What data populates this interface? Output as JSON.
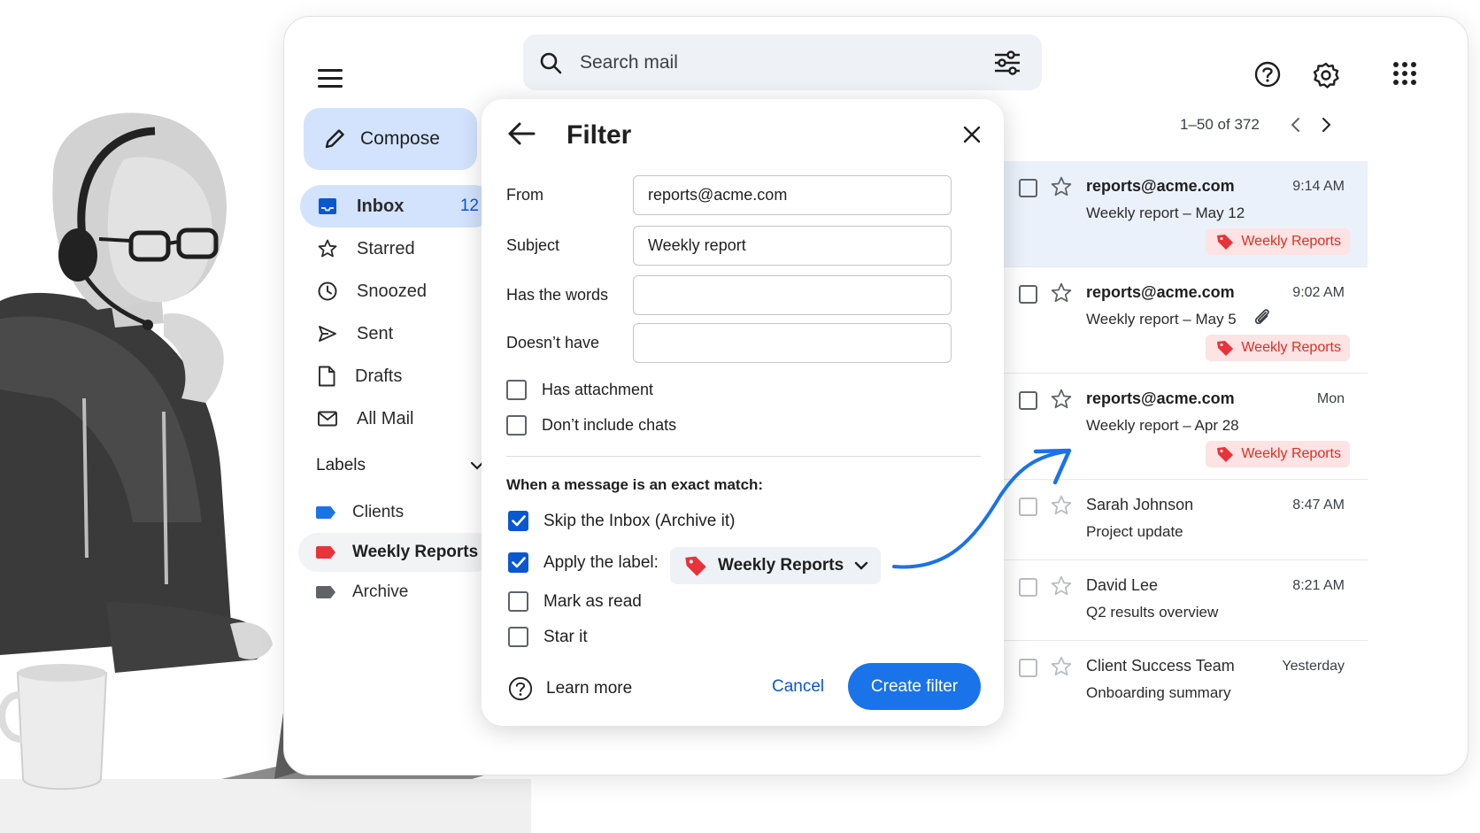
{
  "colors": {
    "accent": "#1a73e8",
    "label_red": "#e8333a",
    "label_blue": "#1a73e8",
    "label_gray": "#5f6368",
    "active_bg": "#d3e3fd"
  },
  "header": {
    "search_placeholder": "Search mail"
  },
  "sidebar": {
    "compose_label": "Compose",
    "items": [
      {
        "label": "Inbox",
        "count": "12",
        "icon": "inbox-icon",
        "active": true
      },
      {
        "label": "Starred",
        "icon": "star-icon"
      },
      {
        "label": "Snoozed",
        "icon": "clock-icon"
      },
      {
        "label": "Sent",
        "icon": "send-icon"
      },
      {
        "label": "Drafts",
        "icon": "draft-icon"
      },
      {
        "label": "All Mail",
        "icon": "mail-icon"
      }
    ],
    "labels_heading": "Labels",
    "labels": [
      {
        "name": "Clients",
        "color": "#1a73e8"
      },
      {
        "name": "Weekly Reports",
        "color": "#e8333a",
        "active": true
      },
      {
        "name": "Archive",
        "color": "#5f6368"
      }
    ]
  },
  "pagination": {
    "text": "1–50 of 372"
  },
  "emails": [
    {
      "sender": "reports@acme.com",
      "subject": "Weekly report – May 12",
      "time": "9:14 AM",
      "label": "Weekly Reports"
    },
    {
      "sender": "reports@acme.com",
      "subject": "Weekly report – May 5",
      "time": "9:02 AM",
      "label": "Weekly Reports",
      "attachment": true
    },
    {
      "sender": "reports@acme.com",
      "subject": "Weekly report – Apr 28",
      "time": "Mon",
      "label": "Weekly Reports"
    },
    {
      "sender": "Sarah Johnson",
      "subject": "Project update",
      "time": "8:47 AM"
    },
    {
      "sender": "David Lee",
      "subject": "Q2 results overview",
      "time": "8:21 AM"
    },
    {
      "sender": "Client Success Team",
      "subject": "Onboarding summary",
      "time": "Yesterday"
    }
  ],
  "filter": {
    "title": "Filter",
    "from_label": "From",
    "from_value": "reports@acme.com",
    "subject_label": "Subject",
    "subject_value": "Weekly report",
    "has_words_label": "Has the words",
    "has_words_value": "",
    "doesnt_have_label": "Doesn’t have",
    "doesnt_have_value": "",
    "has_attachment_label": "Has attachment",
    "no_chats_label": "Don’t include chats",
    "section_title": "When a message is an exact match:",
    "skip_inbox_label": "Skip the Inbox (Archive it)",
    "apply_label_label": "Apply the label:",
    "apply_label_value": "Weekly Reports",
    "mark_read_label": "Mark as read",
    "star_label": "Star it",
    "learn_more": "Learn more",
    "cancel": "Cancel",
    "create": "Create filter"
  }
}
